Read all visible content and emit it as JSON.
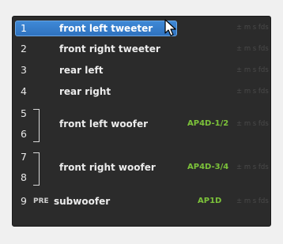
{
  "channels": [
    {
      "num": "1",
      "name": "front left tweeter",
      "timing": "± m s fds",
      "selected": true
    },
    {
      "num": "2",
      "name": "front right tweeter",
      "timing": "± m s fds"
    },
    {
      "num": "3",
      "name": "rear left",
      "timing": "± m s fds"
    },
    {
      "num": "4",
      "name": "rear right",
      "timing": "± m s fds"
    },
    {
      "num": "5"
    },
    {
      "num": "6"
    },
    {
      "num": "7"
    },
    {
      "num": "8"
    },
    {
      "num": "9",
      "prefix": "PRE",
      "name": "subwoofer",
      "tag": "AP1D",
      "timing": "± m s fds"
    }
  ],
  "groups": [
    {
      "name": "front left woofer",
      "tag": "AP4D-1/2",
      "timing": "± m s fds"
    },
    {
      "name": "front right woofer",
      "tag": "AP4D-3/4",
      "timing": "± m s fds"
    }
  ],
  "colors": {
    "selected": "#3a80cf",
    "amp_tag": "#7cc23a",
    "panel_bg": "#2b2b2b"
  },
  "icons": {
    "cursor": "mouse-pointer-icon"
  }
}
